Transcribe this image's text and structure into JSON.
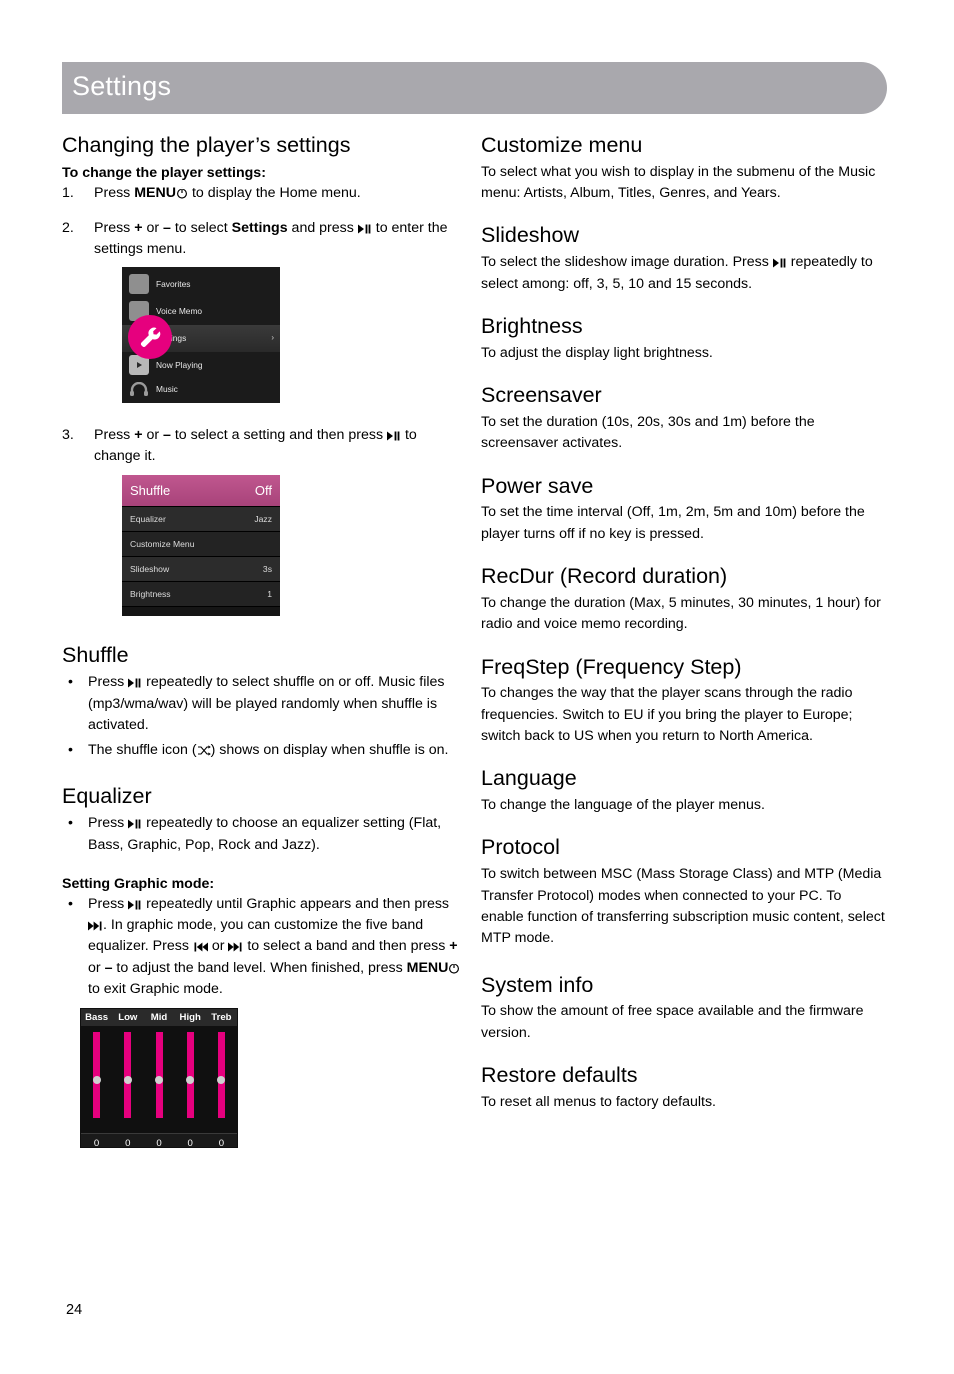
{
  "header": {
    "title": "Settings"
  },
  "page": {
    "number": "24"
  },
  "left": {
    "h_changing": "Changing the player’s settings",
    "lead_bold": "To change the player settings:",
    "steps": [
      {
        "num": "1.",
        "pre": "Press ",
        "bold": "MENU",
        "icon": "power-icon",
        "post": " to display the Home menu."
      },
      {
        "num": "2.",
        "text_a": "Press ",
        "bold_a": "+",
        "mid_a": " or ",
        "bold_b": "–",
        "mid_b": " to select ",
        "bold_c": "Settings",
        "mid_c": " and press ",
        "icon": "play-pause-icon",
        "post": " to enter the settings menu."
      },
      {
        "num": "3.",
        "text_a": "Press ",
        "bold_a": "+",
        "mid_a": " or ",
        "bold_b": "–",
        "mid_b": " to select a setting and then press ",
        "icon": "play-pause-icon",
        "post": " to change it."
      }
    ],
    "home_menu": {
      "items": [
        {
          "label": "Favorites",
          "selected": false
        },
        {
          "label": "Voice Memo",
          "selected": false
        },
        {
          "label": "Settings",
          "selected": true,
          "arrow": "›"
        },
        {
          "label": "Now Playing",
          "selected": false
        },
        {
          "label": "Music",
          "selected": false
        }
      ]
    },
    "settings_menu": {
      "rows": [
        {
          "label": "Shuffle",
          "value": "Off",
          "highlight": true
        },
        {
          "label": "Equalizer",
          "value": "Jazz",
          "highlight": false
        },
        {
          "label": "Customize Menu",
          "value": "",
          "highlight": false
        },
        {
          "label": "Slideshow",
          "value": "3s",
          "highlight": false
        },
        {
          "label": "Brightness",
          "value": "1",
          "highlight": false
        }
      ]
    },
    "h_shuffle": "Shuffle",
    "shuffle_bullets": [
      {
        "pre": "Press ",
        "icon": "play-pause-icon",
        "post": " repeatedly to select shuffle on or off. Music files (mp3/wma/wav) will be played randomly when shuffle is activated."
      },
      {
        "pre": "The shuffle icon (",
        "icon": "shuffle-icon",
        "post": ") shows on display when shuffle is on."
      }
    ],
    "h_equalizer": "Equalizer",
    "equalizer_bullet": {
      "pre": "Press ",
      "icon": "play-pause-icon",
      "post": " repeatedly to choose an equalizer setting (Flat, Bass, Graphic, Pop, Rock and Jazz)."
    },
    "graphic_lead": "Setting Graphic mode:",
    "graphic_bullet": {
      "p1": "Press ",
      "i1": "play-pause-icon",
      "p2": " repeatedly until Graphic appears and then press ",
      "i2": "next-icon",
      "p3": ". In graphic mode, you can customize the five band equalizer. Press ",
      "i3": "prev-icon",
      "p4": " or ",
      "i4": "next-icon",
      "p5": " to select a band and then press ",
      "b1": "+",
      "p6": " or ",
      "b2": "–",
      "p7": " to adjust the band level. When finished, press ",
      "b3": "MENU",
      "i5": "power-icon",
      "p8": " to exit Graphic mode."
    },
    "eq_graphic": {
      "bands": [
        "Bass",
        "Low",
        "Mid",
        "High",
        "Treb"
      ],
      "values": [
        "0",
        "0",
        "0",
        "0",
        "0"
      ]
    }
  },
  "right": {
    "sections": [
      {
        "heading": "Customize menu",
        "body": "To select what you wish to display in the submenu of the Music menu: Artists, Album, Titles, Genres, and Years."
      },
      {
        "heading": "Slideshow",
        "body_pre": "To select the slideshow image duration. Press ",
        "icon": "play-pause-icon",
        "body_post": " repeatedly to select among: off, 3, 5, 10 and 15 seconds."
      },
      {
        "heading": "Brightness",
        "body": "To adjust the display light brightness."
      },
      {
        "heading": "Screensaver",
        "body": "To set the duration (10s, 20s, 30s and 1m) before the screensaver activates."
      },
      {
        "heading": "Power save",
        "body": "To set the time interval (Off, 1m, 2m, 5m and 10m) before the player turns off if no key is pressed."
      },
      {
        "heading": "RecDur (Record duration)",
        "body": "To change the duration (Max, 5 minutes, 30 minutes, 1 hour) for radio and voice memo recording."
      },
      {
        "heading": "FreqStep (Frequency Step)",
        "body": "To changes the way that the player scans through the radio frequencies. Switch to EU if you bring the player to Europe; switch back to US when you return to North America."
      },
      {
        "heading": "Language",
        "body": "To change the language of the player menus."
      },
      {
        "heading": "Protocol",
        "body": "To switch between MSC (Mass Storage Class) and MTP (Media Transfer Protocol) modes when connected to your PC. To enable function of transferring subscription music content, select MTP mode."
      },
      {
        "heading": "System info",
        "body": "To show the amount of free space available and the firmware version."
      },
      {
        "heading": "Restore defaults",
        "body": "To reset all menus to factory defaults."
      }
    ]
  }
}
